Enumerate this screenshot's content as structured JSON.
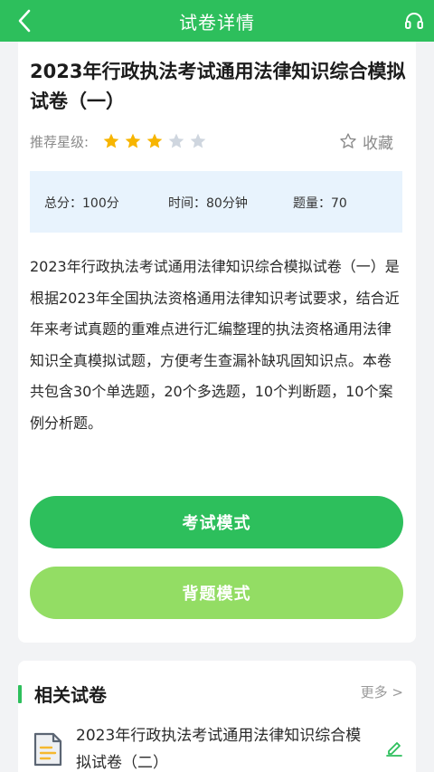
{
  "header": {
    "title": "试卷详情",
    "back_icon": "chevron-left-icon",
    "headset_icon": "headset-icon"
  },
  "paper": {
    "title": "2023年行政执法考试通用法律知识综合模拟试卷（一）",
    "rating_label": "推荐星级:",
    "rating": 3,
    "rating_max": 5,
    "favorite_label": "收藏",
    "stats": {
      "total_score": "总分：100分",
      "time": "时间：80分钟",
      "questions": "题量：70"
    },
    "description": "2023年行政执法考试通用法律知识综合模拟试卷（一）是根据2023年全国执法资格通用法律知识考试要求，结合近年来考试真题的重难点进行汇编整理的执法资格通用法律知识全真模拟试题，方便考生查漏补缺巩固知识点。本卷共包含30个单选题，20个多选题，10个判断题，10个案例分析题。"
  },
  "buttons": {
    "exam_mode": "考试模式",
    "recite_mode": "背题模式"
  },
  "related": {
    "section_title": "相关试卷",
    "more_label": "更多 >",
    "items": [
      {
        "title": "2023年行政执法考试通用法律知识综合模拟试卷（二）"
      }
    ]
  },
  "colors": {
    "primary": "#2dbf5c",
    "secondary": "#93dd64",
    "star_on": "#f7b500",
    "star_off": "#cfd6df",
    "stats_bg": "#e8f3fd"
  }
}
